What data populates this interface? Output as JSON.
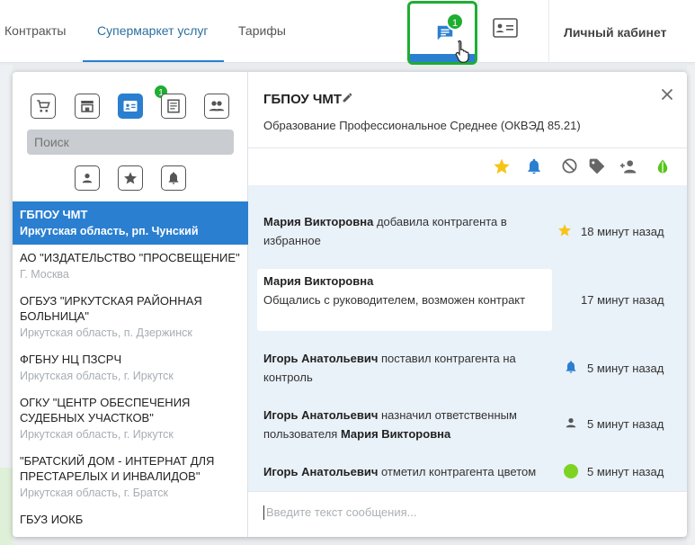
{
  "topbar": {
    "tabs": [
      "Контракты",
      "Супермаркет услуг",
      "Тарифы"
    ],
    "active_tab": 1,
    "messages_badge": "1",
    "cabinet_label": "Личный кабинет"
  },
  "sidebar": {
    "category_badge": "1",
    "search_placeholder": "Поиск",
    "items": [
      {
        "name": "ГБПОУ ЧМТ",
        "address": "Иркутская область, рп. Чунский",
        "active": true
      },
      {
        "name": "АО \"ИЗДАТЕЛЬСТВО \"ПРОСВЕЩЕНИЕ\"",
        "address": "Г. Москва"
      },
      {
        "name": "ОГБУЗ \"ИРКУТСКАЯ РАЙОННАЯ БОЛЬНИЦА\"",
        "address": "Иркутская область, п. Дзержинск"
      },
      {
        "name": "ФГБНУ НЦ ПЗСРЧ",
        "address": "Иркутская область, г. Иркутск"
      },
      {
        "name": "ОГКУ \"ЦЕНТР ОБЕСПЕЧЕНИЯ СУДЕБНЫХ УЧАСТКОВ\"",
        "address": "Иркутская область, г. Иркутск"
      },
      {
        "name": "\"БРАТСКИЙ ДОМ - ИНТЕРНАТ ДЛЯ ПРЕСТАРЕЛЫХ И ИНВАЛИДОВ\"",
        "address": "Иркутская область, г. Братск"
      },
      {
        "name": "ГБУЗ ИОКБ",
        "address": ""
      }
    ]
  },
  "detail": {
    "title": "ГБПОУ ЧМТ",
    "subtitle": "Образование Профессиональное Среднее (ОКВЭД 85.21)",
    "colors": {
      "star": "#f5c518",
      "bell": "#2a7fd0",
      "leaf": "#57c41a",
      "dot": "#7ed321"
    },
    "feed": [
      {
        "actor": "Мария Викторовна",
        "text": " добавила контрагента в избранное",
        "time": "18 минут назад",
        "icon": "star-icon"
      },
      {
        "actor": "Мария Викторовна",
        "text": "Общались с руководителем, возможен контракт",
        "time": "17 минут назад",
        "icon": ""
      },
      {
        "actor": "Игорь Анатольевич",
        "text": " поставил контрагента на контроль",
        "time": "5 минут назад",
        "icon": "bell-icon"
      },
      {
        "actor": "Игорь Анатольевич",
        "text": " назначил ответственным пользователя ",
        "extra": "Мария Викторовна",
        "time": "5 минут назад",
        "icon": "person-icon"
      },
      {
        "actor": "Игорь Анатольевич",
        "text": " отметил контрагента цветом",
        "time": "5 минут назад",
        "icon": "color-dot-icon"
      }
    ],
    "input_placeholder": "Введите текст сообщения..."
  }
}
